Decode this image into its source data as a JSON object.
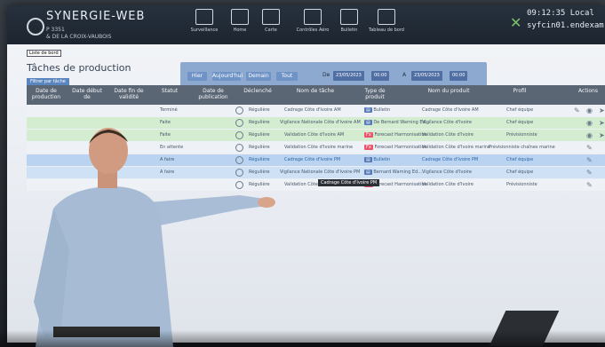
{
  "app": {
    "title": "SYNERGIE-WEB",
    "line1": "P 3351",
    "line2": "& DE LA CROIX-VAUBOIS"
  },
  "nav": [
    {
      "label": "Surveillance"
    },
    {
      "label": "Home"
    },
    {
      "label": "Carte"
    },
    {
      "label": "Contrôles Aéro"
    },
    {
      "label": "Bulletin"
    },
    {
      "label": "Tableau de bord"
    }
  ],
  "status": {
    "clock": "09:12:35 Local",
    "user": "syfcin01.endexam.cin"
  },
  "page": {
    "tag": "Liste de bord",
    "title": "Tâches de production",
    "filter_label": "Filtrer par tâche"
  },
  "toolbar": {
    "buttons": [
      "Hier",
      "Aujourd'hui",
      "Demain",
      "Tout"
    ],
    "de_label": "De",
    "a_label": "A",
    "date_from": "23/05/2023",
    "time_from": "00:00",
    "date_to": "23/05/2023",
    "time_to": "00:00"
  },
  "table": {
    "headers": [
      "Date de production",
      "Date début de",
      "Date fin de validité",
      "Statut",
      "Date de publication",
      "Déclenché",
      "Nom de tâche",
      "Type de produit",
      "Nom du produit",
      "Profil",
      "Actions"
    ],
    "rows": [
      {
        "task": "Cadrage Côte d'Ivoire AM",
        "type": "Bulletin",
        "product": "Cadrage Côte d'Ivoire AM",
        "profile": "Chef équipe",
        "state": "Terminé",
        "trig": "Régulière",
        "tone": "plain"
      },
      {
        "task": "Vigilance Nationale Côte d'Ivoire AM",
        "type": "De Bernard Warning Ed...",
        "product": "Vigilance Côte d'Ivoire",
        "profile": "Chef équipe",
        "state": "Faite",
        "trig": "Régulière",
        "tone": "green"
      },
      {
        "task": "Validation Côte d'Ivoire AM",
        "type": "Forecast Harmonisation",
        "product": "Validation Côte d'Ivoire",
        "profile": "Prévisionniste",
        "state": "Faite",
        "trig": "Régulière",
        "tone": "green"
      },
      {
        "task": "Validation Côte d'Ivoire marine",
        "type": "Forecast Harmonisation",
        "product": "Validation Côte d'Ivoire marine",
        "profile": "Prévisionniste chaînes marine",
        "state": "En attente",
        "trig": "Régulière",
        "tone": "plain"
      },
      {
        "task": "Cadrage Côte d'Ivoire PM",
        "type": "Bulletin",
        "product": "Cadrage Côte d'Ivoire PM",
        "profile": "Chef équipe",
        "state": "A faire",
        "trig": "Régulière",
        "tone": "blue"
      },
      {
        "task": "Vigilance Nationale Côte d'Ivoire PM",
        "type": "Bernard Warning Ed...",
        "product": "Vigilance Côte d'Ivoire",
        "profile": "Chef équipe",
        "state": "A faire",
        "trig": "Régulière",
        "tone": "blue"
      },
      {
        "task": "Validation Côte d'Ivoire PM",
        "type": "Forecast Harmonisation",
        "product": "Validation Côte d'Ivoire",
        "profile": "Prévisionniste",
        "state": "",
        "trig": "Régulière",
        "tone": "plain"
      }
    ],
    "tooltip": "Cadrage Côte d'Ivoire PM"
  },
  "colors": {
    "topbar": "#1c2530",
    "header": "#5b6675",
    "row_green": "#d4ecd0",
    "row_blue": "#cfe1f4",
    "accent": "#5a86c0"
  }
}
